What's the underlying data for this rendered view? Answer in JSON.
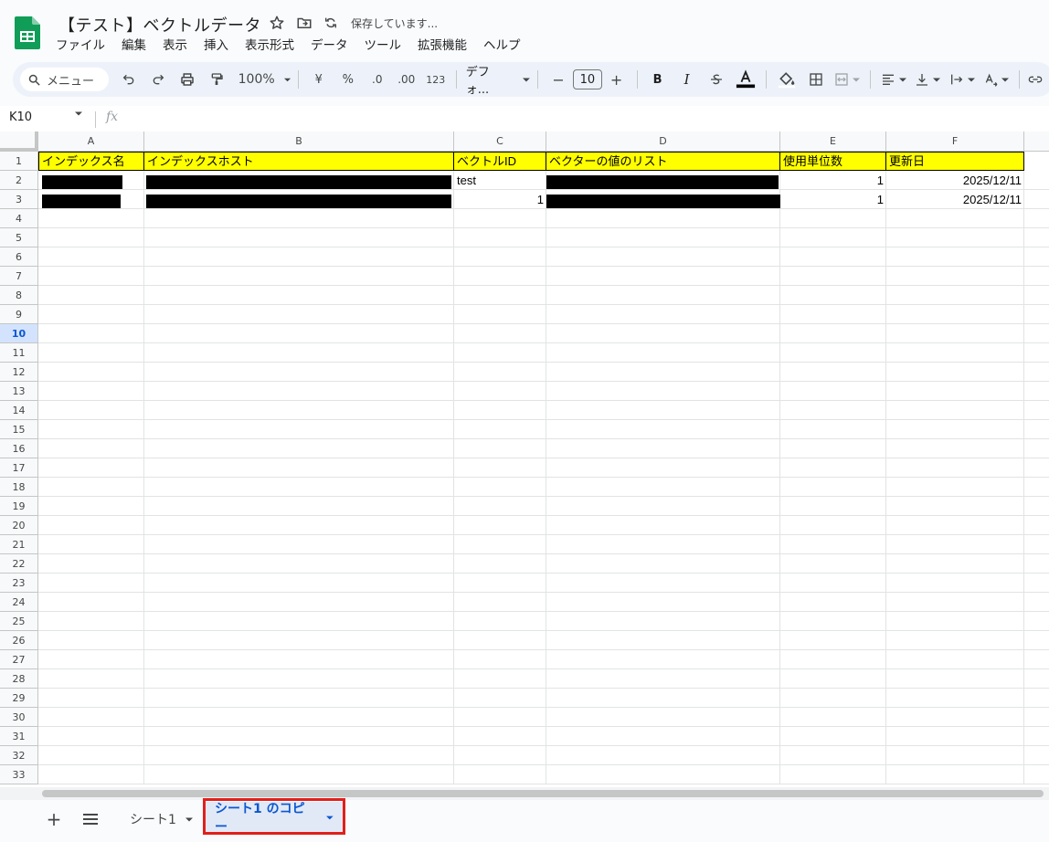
{
  "doc": {
    "title": "【テスト】ベクトルデータ",
    "save_status": "保存しています..."
  },
  "menu": [
    "ファイル",
    "編集",
    "表示",
    "挿入",
    "表示形式",
    "データ",
    "ツール",
    "拡張機能",
    "ヘルプ"
  ],
  "toolbar": {
    "search_label": "メニュー",
    "zoom": "100%",
    "currency": "¥",
    "percent": "%",
    "dec_decrease": ".0",
    "dec_increase": ".00",
    "number_format": "123",
    "font": "デフォ...",
    "font_size": "10",
    "minus": "−",
    "plus": "+",
    "bold": "B",
    "italic": "I"
  },
  "formula_bar": {
    "name_box": "K10",
    "fx": "fx"
  },
  "grid": {
    "columns": [
      "A",
      "B",
      "C",
      "D",
      "E",
      "F"
    ],
    "rows": [
      "1",
      "2",
      "3",
      "4",
      "5",
      "6",
      "7",
      "8",
      "9",
      "10",
      "11",
      "12",
      "13",
      "14",
      "15",
      "16",
      "17",
      "18",
      "19",
      "20",
      "21",
      "22",
      "23",
      "24",
      "25",
      "26",
      "27",
      "28",
      "29",
      "30",
      "31",
      "32",
      "33"
    ],
    "selected_row": "10",
    "header_cells": [
      "インデックス名",
      "インデックスホスト",
      "ベクトルID",
      "ベクターの値のリスト",
      "使用単位数",
      "更新日"
    ],
    "row2": {
      "c": "test",
      "e": "1",
      "f": "2025/12/11"
    },
    "row3": {
      "c": "1",
      "e": "1",
      "f": "2025/12/11"
    }
  },
  "sheets": {
    "add": "+",
    "tab1": "シート1",
    "tab2": "シート1 のコピー"
  },
  "colors": {
    "header_fill": "#ffff00",
    "accent": "#0b57d0",
    "highlight": "#e0201a"
  }
}
